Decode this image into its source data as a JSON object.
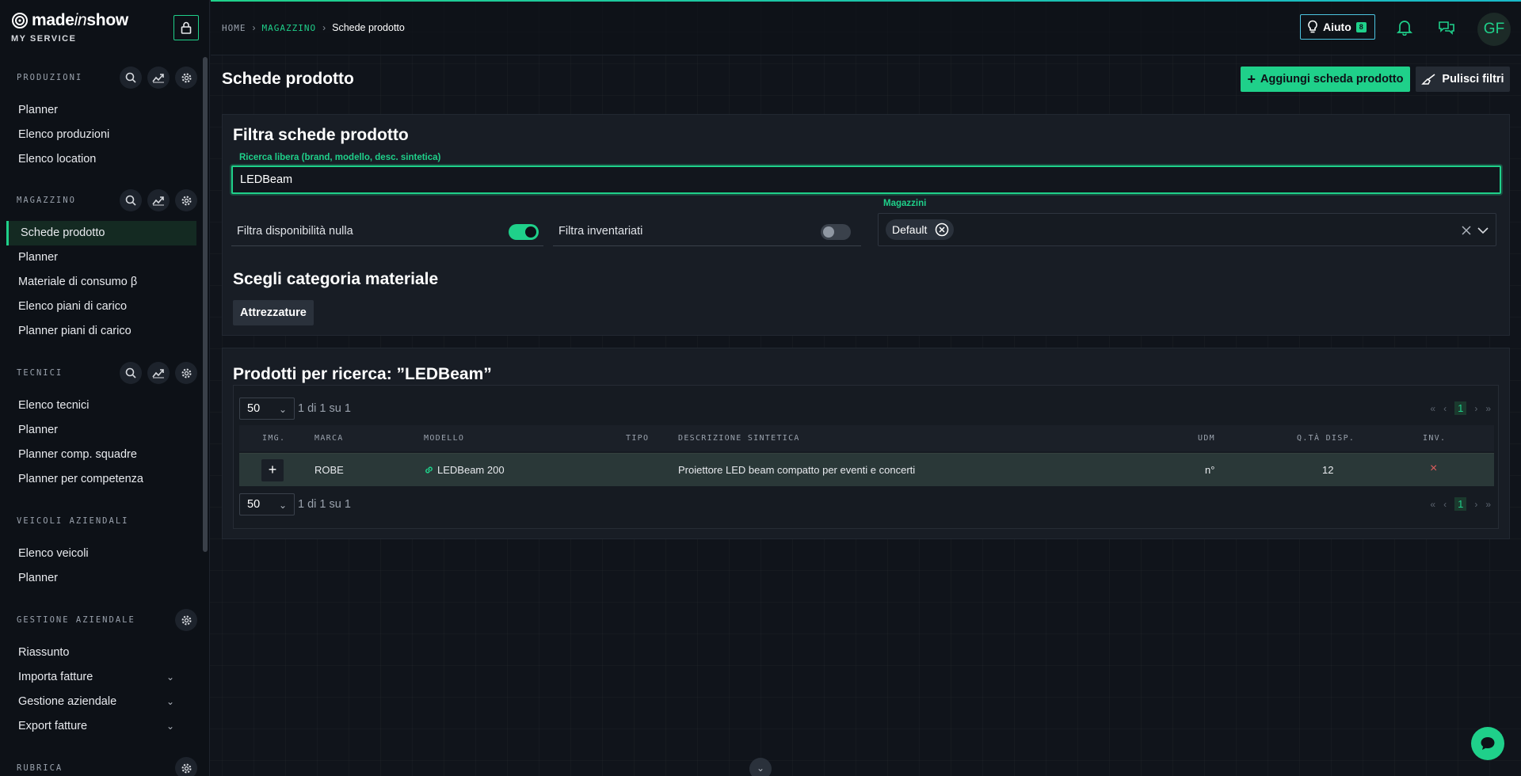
{
  "brand": {
    "name_prefix": "made",
    "name_italic": "in",
    "name_suffix": "show",
    "subtitle": "MY SERVICE"
  },
  "sidebar": {
    "sections": [
      {
        "title": "PRODUZIONI",
        "items": [
          "Planner",
          "Elenco produzioni",
          "Elenco location"
        ]
      },
      {
        "title": "MAGAZZINO",
        "items": [
          "Schede prodotto",
          "Planner",
          "Materiale di consumo β",
          "Elenco piani di carico",
          "Planner piani di carico"
        ]
      },
      {
        "title": "TECNICI",
        "items": [
          "Elenco tecnici",
          "Planner",
          "Planner comp. squadre",
          "Planner per competenza"
        ]
      },
      {
        "title": "VEICOLI AZIENDALI",
        "items": [
          "Elenco veicoli",
          "Planner"
        ]
      },
      {
        "title": "GESTIONE AZIENDALE",
        "items": [
          "Riassunto",
          "Importa fatture",
          "Gestione aziendale",
          "Export fatture"
        ]
      },
      {
        "title": "RUBRICA",
        "items": []
      }
    ]
  },
  "topbar": {
    "breadcrumb": [
      "HOME",
      "MAGAZZINO",
      "Schede prodotto"
    ],
    "help_label": "Aiuto",
    "help_badge": "8",
    "avatar_initials": "GF"
  },
  "page": {
    "title": "Schede prodotto",
    "add_button": "Aggiungi scheda prodotto",
    "clear_button": "Pulisci filtri"
  },
  "filters": {
    "title": "Filtra schede prodotto",
    "search_label": "Ricerca libera (brand, modello, desc. sintetica)",
    "search_value": "LEDBeam",
    "toggle_zero_label": "Filtra disponibilità nulla",
    "toggle_zero_on": true,
    "toggle_inv_label": "Filtra inventariati",
    "toggle_inv_on": false,
    "warehouses_label": "Magazzini",
    "warehouse_chip": "Default",
    "category_title": "Scegli categoria materiale",
    "category_button": "Attrezzature"
  },
  "results": {
    "title": "Prodotti per ricerca: ”LEDBeam”",
    "per_page": "50",
    "count_text": "1 di 1 su 1",
    "current_page": "1",
    "columns": [
      "IMG.",
      "MARCA",
      "MODELLO",
      "TIPO",
      "DESCRIZIONE SINTETICA",
      "UDM",
      "Q.TÀ DISP.",
      "INV."
    ],
    "rows": [
      {
        "brand": "ROBE",
        "model": "LEDBeam 200",
        "type": "",
        "description": "Proiettore LED beam compatto per eventi e concerti",
        "udm": "n°",
        "qty": "12",
        "inv": "×"
      }
    ]
  },
  "colors": {
    "accent": "#1fd08a",
    "background": "#10141b",
    "danger": "#e05d5d"
  }
}
